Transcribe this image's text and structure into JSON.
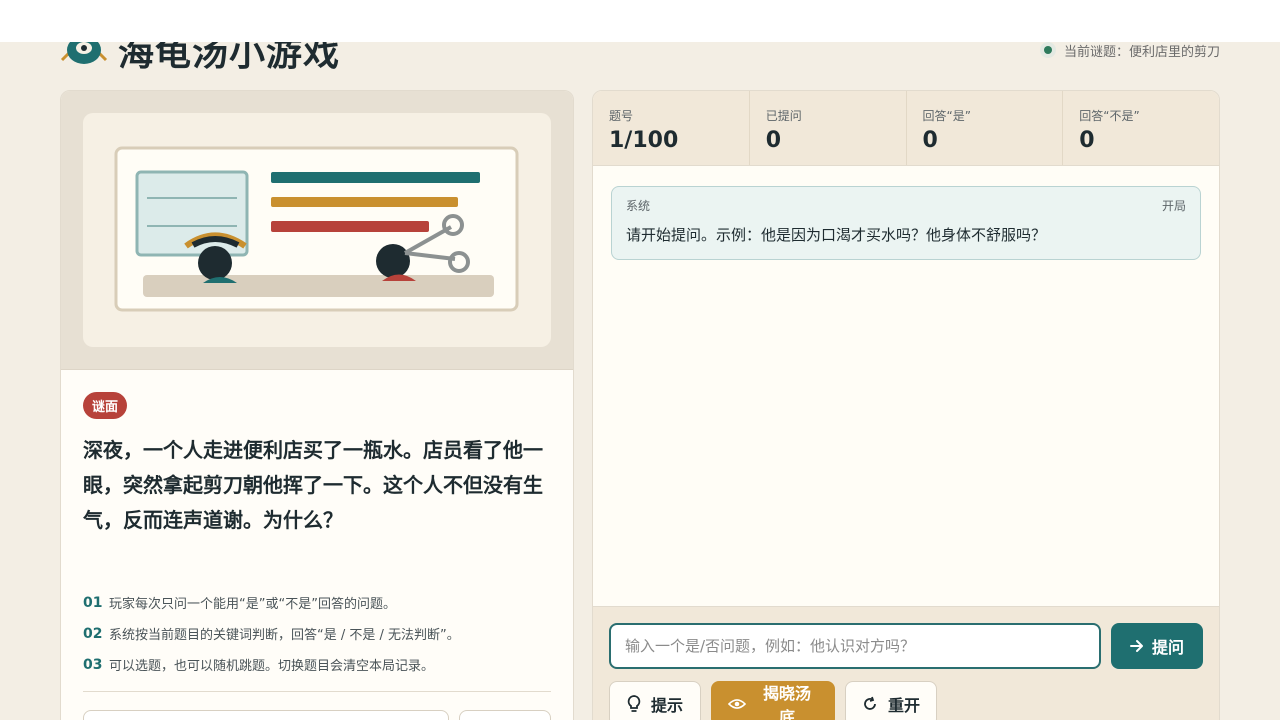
{
  "header": {
    "title": "海龟汤小游戏",
    "current_puzzle_label": "当前谜题：便利店里的剪刀"
  },
  "puzzle": {
    "badge": "谜面",
    "text": "深夜，一个人走进便利店买了一瓶水。店员看了他一眼，突然拿起剪刀朝他挥了一下。这个人不但没有生气，反而连声道谢。为什么？"
  },
  "rules": [
    {
      "num": "01",
      "text": "玩家每次只问一个能用“是”或“不是”回答的问题。"
    },
    {
      "num": "02",
      "text": "系统按当前题目的关键词判断，回答“是 / 不是 / 无法判断”。"
    },
    {
      "num": "03",
      "text": "可以选题，也可以随机跳题。切换题目会清空本局记录。"
    }
  ],
  "stats": [
    {
      "label": "题号",
      "value": "1/100"
    },
    {
      "label": "已提问",
      "value": "0"
    },
    {
      "label": "回答“是”",
      "value": "0"
    },
    {
      "label": "回答“不是”",
      "value": "0"
    }
  ],
  "chat": {
    "messages": [
      {
        "sender": "系统",
        "tag": "开局",
        "text": "请开始提问。示例：他是因为口渴才买水吗？他身体不舒服吗？"
      }
    ]
  },
  "composer": {
    "placeholder": "输入一个是/否问题，例如：他认识对方吗？",
    "ask_label": "提问",
    "hint_label": "提示",
    "reveal_label": "揭晓汤底",
    "restart_label": "重开"
  },
  "colors": {
    "accent_teal": "#1f6f70",
    "accent_gold": "#c9902f",
    "badge_red": "#b7423a",
    "status_green": "#2e7a5c"
  }
}
